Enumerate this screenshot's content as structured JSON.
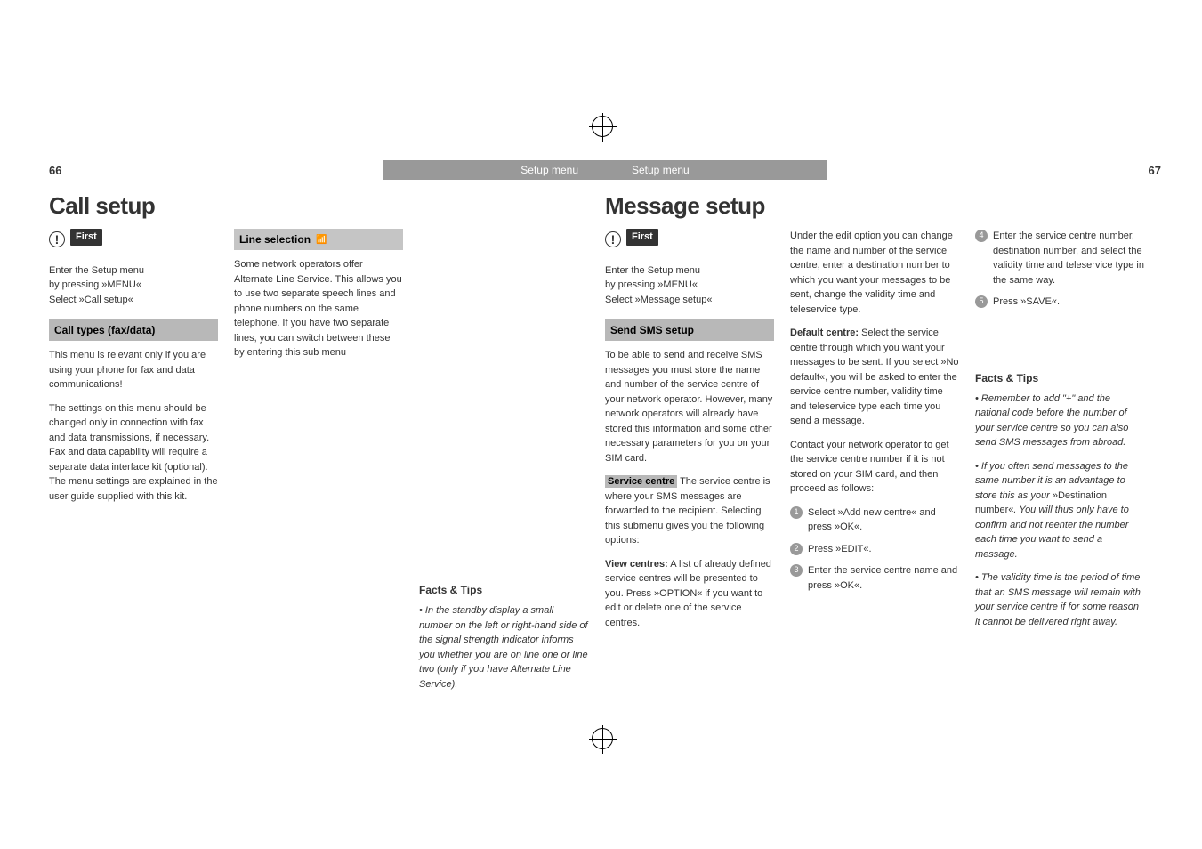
{
  "left_page_num": "66",
  "right_page_num": "67",
  "header_label_left": "Setup menu",
  "header_label_right": "Setup menu",
  "left_title": "Call setup",
  "right_title": "Message setup",
  "first_tag": "First",
  "first_box_a_line1": "Enter the Setup menu",
  "first_box_a_line2": "by pressing »MENU«",
  "first_box_a_line3": "Select »Call setup«",
  "call_types_heading": "Call types (fax/data)",
  "call_types_p1": "This menu is relevant only if you are using your phone for fax and data communications!",
  "call_types_p2": "The settings on this menu should be changed only in connection with fax and data transmissions, if necessary. Fax and data capability will require a separate data interface kit (optional). The menu settings are explained in the user guide supplied with this kit.",
  "line_selection_heading": "Line selection",
  "line_selection_p": "Some network operators offer Alternate Line Service. This allows you to use two separate speech lines and phone numbers on the same telephone. If you have two separate lines, you can switch between these by entering this sub menu",
  "facts_heading": "Facts & Tips",
  "facts_left_p": "• In the standby display a small number on the left or right-hand side of the signal strength indicator informs you whether you are on line one or line two (only if you have Alternate Line Service).",
  "first_box_b_line1": "Enter the Setup menu",
  "first_box_b_line2": "by pressing »MENU«",
  "first_box_b_line3": "Select »Message setup«",
  "send_sms_heading": "Send SMS setup",
  "send_sms_p": "To be able to send and receive SMS messages you must store the name and number of the service centre of your network operator. However, many network operators will already have stored this information and some other necessary parameters for you on your SIM card.",
  "service_centre_label": "Service centre",
  "service_centre_tail": " The service centre is where your SMS messages are forwarded to the recipient. Selecting this submenu gives you the following options:",
  "view_centres_bold": "View centres:",
  "view_centres_text": " A list of already defined service centres will be presented to you. Press »OPTION« if you want to edit or delete one of the service centres.",
  "col5_p1": "Under the edit option you can change the name and number of the service centre, enter a destination number to which you want your messages to be sent, change the validity time and teleservice type.",
  "default_centre_bold": "Default centre:",
  "default_centre_text": " Select the service centre through which you want your messages to be sent. If you select »No default«, you will be asked to enter the service centre number, validity time and teleservice type each time you send a message.",
  "col5_p3": "Contact your network operator to get the service centre number if it is not stored on your SIM card, and then proceed as follows:",
  "step1": "Select »Add new centre« and press »OK«.",
  "step2": "Press »EDIT«.",
  "step3": "Enter the service centre name and press »OK«.",
  "step4": "Enter the service centre number, destination number, and select the validity time and teleservice type in the same way.",
  "step5": "Press »SAVE«.",
  "facts_right_1": "• Remember to add \"+\" and the national code before the number of your service centre so you can also send SMS messages from abroad.",
  "facts_right_2a": "• If you often send messages to the same number it is an advantage to store this as your ",
  "facts_right_2b": "»Destination number«",
  "facts_right_2c": ". You will thus only have to confirm and not reenter the number each time you want to send a message.",
  "facts_right_3": "• The validity time is the period of time that an SMS message will remain with your service centre if for some reason it cannot be delivered right away."
}
